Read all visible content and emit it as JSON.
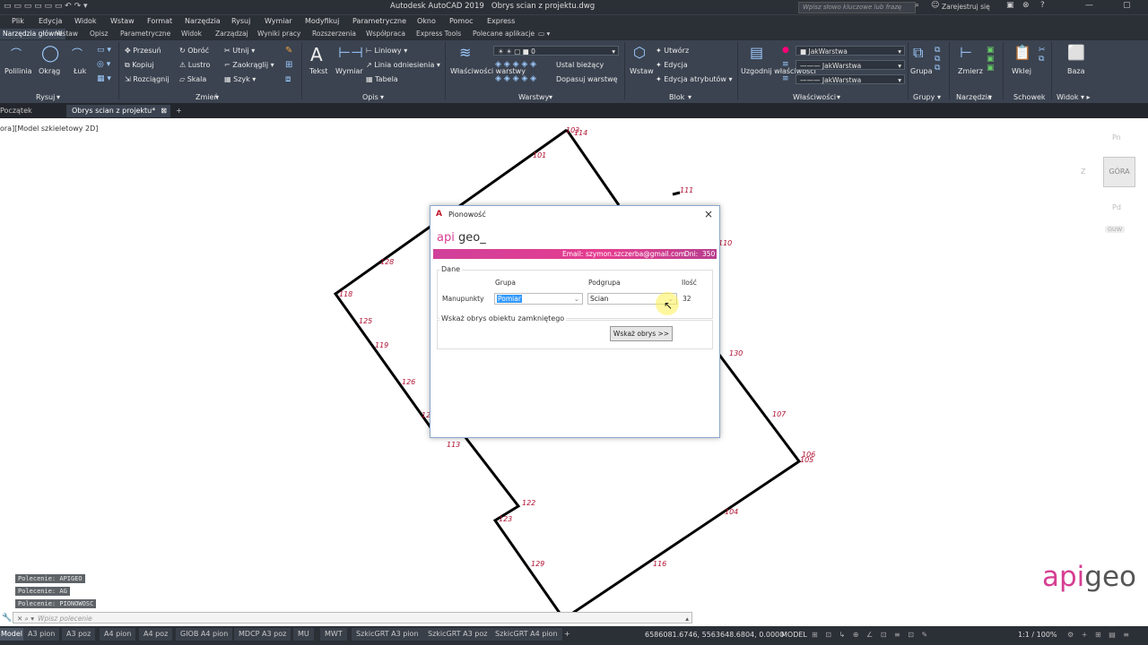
{
  "title_bar": {
    "app_title": "Autodesk AutoCAD 2019",
    "doc_title": "Obrys scian z projektu.dwg",
    "search_placeholder": "Wpisz słowo kluczowe lub frazę",
    "signin": "Zarejestruj się"
  },
  "menu": [
    "Plik",
    "Edycja",
    "Widok",
    "Wstaw",
    "Format",
    "Narzędzia",
    "Rysuj",
    "Wymiar",
    "Modyfikuj",
    "Parametryczne",
    "Okno",
    "Pomoc",
    "Express"
  ],
  "ribbon_tabs": [
    "Narzędzia główne",
    "Wstaw",
    "Opisz",
    "Parametryczne",
    "Widok",
    "Zarządzaj",
    "Wyniki pracy",
    "Rozszerzenia",
    "Współpraca",
    "Express Tools",
    "Polecane aplikacje"
  ],
  "ribbon": {
    "draw": {
      "polyline": "Polilinia",
      "circle": "Okrąg",
      "arc": "Łuk",
      "panel": "Rysuj"
    },
    "modify": {
      "move": "Przesuń",
      "copy": "Kopiuj",
      "stretch": "Rozciągnij",
      "rotate": "Obróć",
      "mirror": "Lustro",
      "scale": "Skala",
      "trim": "Utnij",
      "fillet": "Zaokrąglij",
      "array": "Szyk",
      "panel": "Zmień"
    },
    "annotation": {
      "text": "Tekst",
      "dimension": "Wymiar",
      "linear": "Liniowy",
      "leader": "Linia odniesienia",
      "table": "Tabela",
      "panel": "Opis"
    },
    "layers": {
      "properties": "Właściwości warstwy",
      "current_layer": "0",
      "set_current": "Ustal bieżący",
      "match_layer": "Dopasuj warstwę",
      "panel": "Warstwy"
    },
    "block": {
      "insert": "Wstaw",
      "create": "Utwórz",
      "edit": "Edycja",
      "edit_attr": "Edycja atrybutów",
      "panel": "Blok"
    },
    "properties": {
      "match": "Uzgodnij właściwości",
      "color": "JakWarstwa",
      "linetype": "JakWarstwa",
      "lineweight": "JakWarstwa",
      "panel": "Właściwości"
    },
    "groups": {
      "group": "Grupa",
      "panel": "Grupy"
    },
    "utilities": {
      "measure": "Zmierz",
      "panel": "Narzędzia"
    },
    "clipboard": {
      "paste": "Wklej",
      "panel": "Schowek"
    },
    "view": {
      "base": "Baza",
      "panel": "Widok"
    }
  },
  "file_tabs": [
    {
      "label": "Początek",
      "active": false
    },
    {
      "label": "Obrys scian z projektu*",
      "active": true
    }
  ],
  "view_label": "ora][Model szkieletowy 2D]",
  "viewcube": {
    "top": "GÓRA",
    "wcs": "GUW",
    "n": "Pn",
    "s": "Pd",
    "w": "Z"
  },
  "points": [
    "101",
    "103",
    "111",
    "114",
    "110",
    "118",
    "125",
    "119",
    "126",
    "130",
    "107",
    "106",
    "105",
    "104",
    "122",
    "123",
    "128",
    "129",
    "116",
    "113",
    "112",
    "127"
  ],
  "command_history": [
    "Polecenie: APIGEO",
    "Polecenie: AG",
    "Polecenie: PIONOWOSC"
  ],
  "command_placeholder": "Wpisz polecenie",
  "layout_tabs": [
    "Model",
    "A3 pion",
    "A3 poz",
    "A4 pion",
    "A4 poz",
    "GIOB A4 pion",
    "MDCP A3 poz",
    "MU",
    "MWT",
    "SzkicGRT A3 pion",
    "SzkicGRT A3 poz",
    "SzkicGRT A4 pion"
  ],
  "status": {
    "coords": "6586081.6746, 5563648.6804, 0.0000",
    "mode": "MODEL",
    "scale": "1:1 / 100%"
  },
  "apigeo_logo": {
    "api": "api",
    "geo": "geo"
  },
  "dialog": {
    "title": "Pionowość",
    "logo_api": "api",
    "logo_geo": "geo_",
    "email_label": "Email:",
    "email": "szymon.szczerba@gmail.com",
    "days_label": "Dni:",
    "days": "350",
    "group_box": "Dane",
    "col_group": "Grupa",
    "col_subgroup": "Podgrupa",
    "col_count": "Ilość",
    "row_label": "Manupunkty",
    "group_value": "Pomiar",
    "subgroup_value": "Scian",
    "count_value": "32",
    "outline_box": "Wskaż obrys obiektu zamkniętego",
    "outline_button": "Wskaż obrys >>"
  },
  "colors": {
    "accent": "#d63e92",
    "point_label": "#b01030",
    "ribbon_bg": "#3b4350"
  }
}
